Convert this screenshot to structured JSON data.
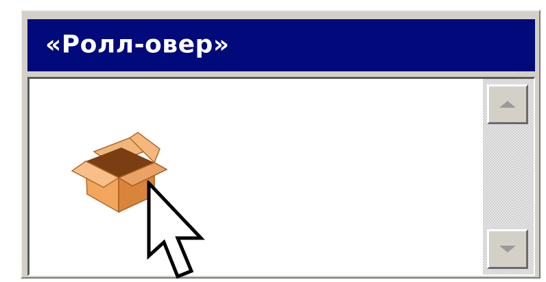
{
  "window": {
    "title": "«Ролл-овер»"
  },
  "colors": {
    "titlebar_bg": "#000a7a",
    "titlebar_text": "#ffffff",
    "frame": "#d4d0c8",
    "content_bg": "#ffffff",
    "box_orange": "#e49a4f"
  },
  "content": {
    "icon": "open-box-icon",
    "pointer": "arrow-cursor-icon"
  },
  "scrollbar": {
    "up_icon": "arrow-up-icon",
    "down_icon": "arrow-down-icon"
  }
}
